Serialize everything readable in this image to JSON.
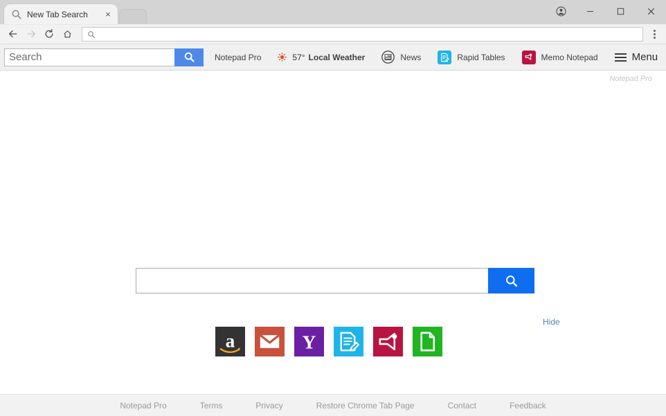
{
  "window": {
    "tab": {
      "title": "New Tab Search",
      "favicon": "search-icon",
      "close": "×"
    },
    "controls": {
      "profile": "profile-icon",
      "minimize": "—",
      "maximize": "□",
      "close": "✕"
    }
  },
  "omnibox": {
    "value": "",
    "icon": "search-icon",
    "back": "back-arrow-icon",
    "forward": "forward-arrow-icon",
    "reload": "reload-icon",
    "home": "home-icon",
    "menu": "three-dots-icon"
  },
  "ext_toolbar": {
    "search_placeholder": "Search",
    "search_value": "",
    "search_button_icon": "magnifier-icon",
    "links": [
      {
        "label": "Notepad Pro",
        "icon": null,
        "icon_color": null
      },
      {
        "label": "Local Weather",
        "temp": "57°",
        "icon": "sun-icon",
        "icon_color": "#e8462a",
        "bold": true
      },
      {
        "label": "News",
        "icon": "newspaper-icon",
        "icon_color": "#4a4a4a"
      },
      {
        "label": "Rapid Tables",
        "icon": "notepad-icon",
        "icon_color": "#1fb4e8"
      },
      {
        "label": "Memo Notepad",
        "icon": "memo-icon",
        "icon_color": "#b81442"
      }
    ],
    "menu_label": "Menu",
    "menu_icon": "hamburger-icon"
  },
  "page": {
    "brand": "Notepad Pro",
    "search_value": "",
    "search_button_icon": "magnifier-icon",
    "hide_label": "Hide",
    "tiles": [
      {
        "name": "amazon",
        "color": "#333333",
        "glyph": "a"
      },
      {
        "name": "gmail",
        "color": "#c8523c",
        "glyph": "envelope"
      },
      {
        "name": "yahoo",
        "color": "#6b1fa3",
        "glyph": "Y"
      },
      {
        "name": "rapid-tables",
        "color": "#1fb4e8",
        "glyph": "notepad"
      },
      {
        "name": "memo-notepad",
        "color": "#b81442",
        "glyph": "memo"
      },
      {
        "name": "new-document",
        "color": "#21b521",
        "glyph": "document"
      }
    ]
  },
  "footer": {
    "links": [
      "Notepad Pro",
      "Terms",
      "Privacy",
      "Restore Chrome Tab Page",
      "Contact",
      "Feedback"
    ]
  },
  "colors": {
    "accent_blue": "#0f6ef0",
    "toolbar_blue": "#4e89e8",
    "link_blue": "#5781b5",
    "titlebar": "#d4d4d4",
    "toolbar_bg": "#f0f0f0",
    "footer_bg": "#f2f2f2"
  }
}
